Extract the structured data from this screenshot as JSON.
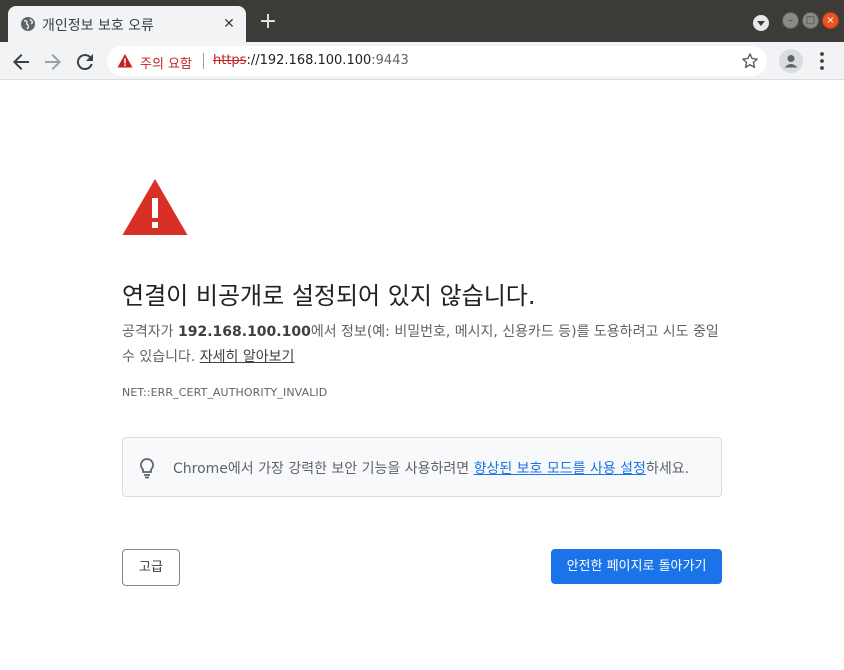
{
  "browser": {
    "tab_title": "개인정보 보호 오류",
    "tab_close": "✕",
    "new_tab": "+",
    "security_label": "주의 요함",
    "url_scheme": "https",
    "url_host": "://192.168.100.100",
    "url_port": ":9443"
  },
  "page": {
    "heading": "연결이 비공개로 설정되어 있지 않습니다.",
    "desc_prefix": "공격자가 ",
    "desc_host": "192.168.100.100",
    "desc_suffix": "에서 정보(예: 비밀번호, 메시지, 신용카드 등)를 도용하려고 시도 중일 수 있습니다. ",
    "learn_more": "자세히 알아보기",
    "error_code": "NET::ERR_CERT_AUTHORITY_INVALID",
    "enhanced_prefix": "Chrome에서 가장 강력한 보안 기능을 사용하려면 ",
    "enhanced_link": "향상된 보호 모드를 사용 설정",
    "enhanced_suffix": "하세요.",
    "advanced_button": "고급",
    "back_button": "안전한 페이지로 돌아가기"
  },
  "colors": {
    "warning_red": "#d93025",
    "link_blue": "#1a73e8",
    "titlebar": "#3c3b37"
  }
}
